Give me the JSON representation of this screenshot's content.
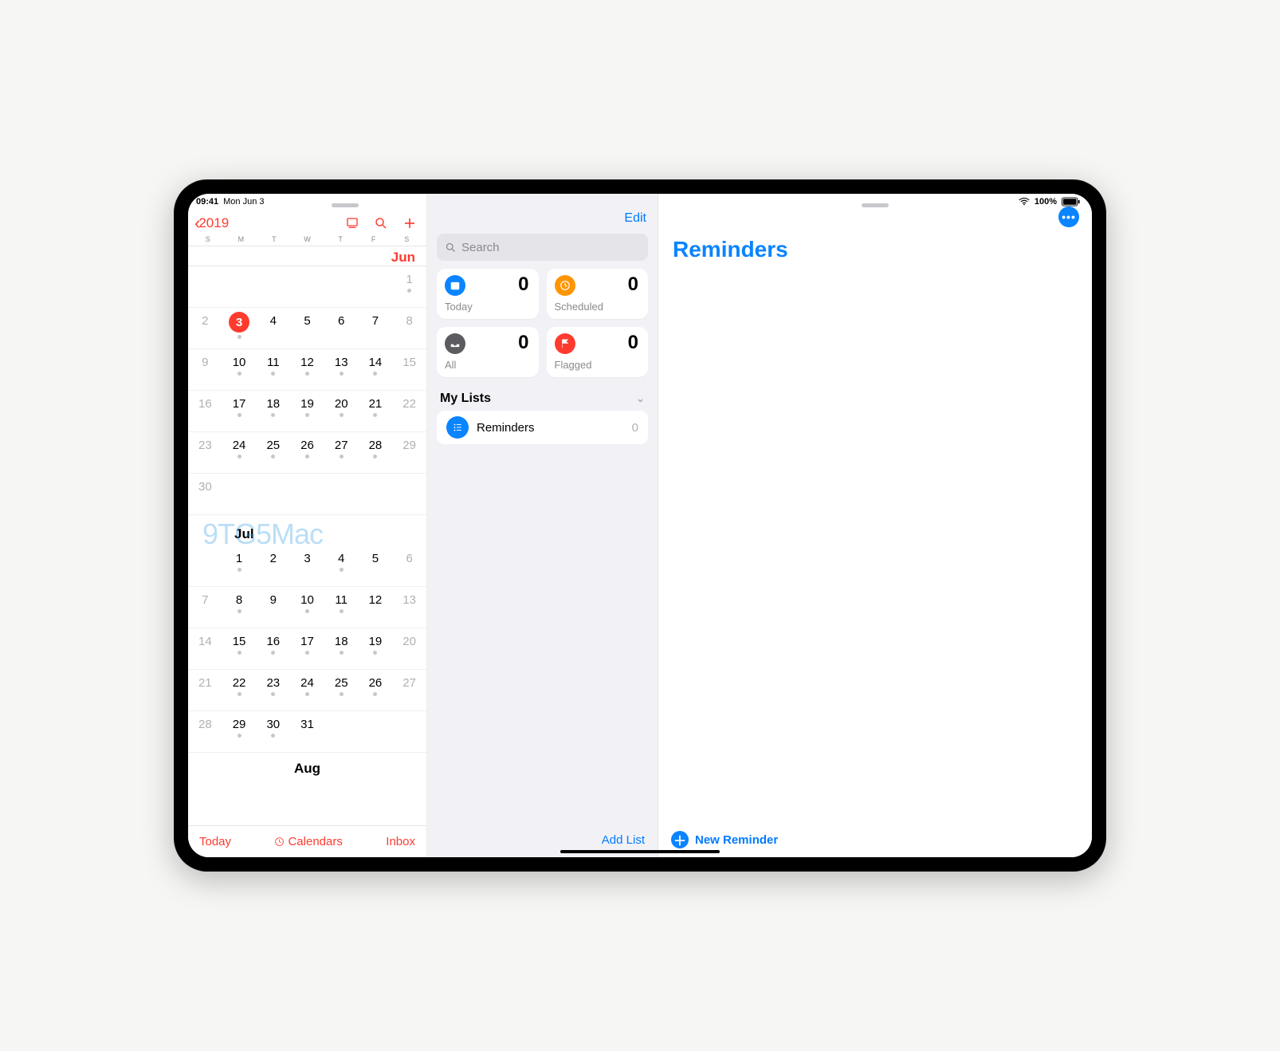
{
  "status": {
    "time": "09:41",
    "date": "Mon Jun 3",
    "battery": "100%"
  },
  "calendar": {
    "back_year": "2019",
    "weekdays": [
      "S",
      "M",
      "T",
      "W",
      "T",
      "F",
      "S"
    ],
    "month_jun": "Jun",
    "month_jul": "Jul",
    "month_aug": "Aug",
    "today_btn": "Today",
    "calendars_btn": "Calendars",
    "inbox_btn": "Inbox",
    "jun": {
      "days": [
        {
          "n": "",
          "w": true
        },
        {
          "n": "",
          "w": false
        },
        {
          "n": "",
          "w": false
        },
        {
          "n": "",
          "w": false
        },
        {
          "n": "",
          "w": false
        },
        {
          "n": "",
          "w": false
        },
        {
          "n": "1",
          "w": true,
          "dot": true
        },
        {
          "n": "2",
          "w": true
        },
        {
          "n": "3",
          "w": false,
          "today": true,
          "dot": true
        },
        {
          "n": "4",
          "w": false
        },
        {
          "n": "5",
          "w": false
        },
        {
          "n": "6",
          "w": false
        },
        {
          "n": "7",
          "w": false
        },
        {
          "n": "8",
          "w": true
        },
        {
          "n": "9",
          "w": true
        },
        {
          "n": "10",
          "w": false,
          "dot": true
        },
        {
          "n": "11",
          "w": false,
          "dot": true
        },
        {
          "n": "12",
          "w": false,
          "dot": true
        },
        {
          "n": "13",
          "w": false,
          "dot": true
        },
        {
          "n": "14",
          "w": false,
          "dot": true
        },
        {
          "n": "15",
          "w": true
        },
        {
          "n": "16",
          "w": true
        },
        {
          "n": "17",
          "w": false,
          "dot": true
        },
        {
          "n": "18",
          "w": false,
          "dot": true
        },
        {
          "n": "19",
          "w": false,
          "dot": true
        },
        {
          "n": "20",
          "w": false,
          "dot": true
        },
        {
          "n": "21",
          "w": false,
          "dot": true
        },
        {
          "n": "22",
          "w": true
        },
        {
          "n": "23",
          "w": true
        },
        {
          "n": "24",
          "w": false,
          "dot": true
        },
        {
          "n": "25",
          "w": false,
          "dot": true
        },
        {
          "n": "26",
          "w": false,
          "dot": true
        },
        {
          "n": "27",
          "w": false,
          "dot": true
        },
        {
          "n": "28",
          "w": false,
          "dot": true
        },
        {
          "n": "29",
          "w": true
        },
        {
          "n": "30",
          "w": true
        },
        {
          "n": "",
          "w": false
        },
        {
          "n": "",
          "w": false
        },
        {
          "n": "",
          "w": false
        },
        {
          "n": "",
          "w": false
        },
        {
          "n": "",
          "w": false
        },
        {
          "n": "",
          "w": true
        }
      ]
    },
    "jul": {
      "days": [
        {
          "n": "",
          "w": true
        },
        {
          "n": "1",
          "w": false,
          "dot": true
        },
        {
          "n": "2",
          "w": false
        },
        {
          "n": "3",
          "w": false
        },
        {
          "n": "4",
          "w": false,
          "dot": true
        },
        {
          "n": "5",
          "w": false
        },
        {
          "n": "6",
          "w": true
        },
        {
          "n": "7",
          "w": true
        },
        {
          "n": "8",
          "w": false,
          "dot": true
        },
        {
          "n": "9",
          "w": false
        },
        {
          "n": "10",
          "w": false,
          "dot": true
        },
        {
          "n": "11",
          "w": false,
          "dot": true
        },
        {
          "n": "12",
          "w": false
        },
        {
          "n": "13",
          "w": true
        },
        {
          "n": "14",
          "w": true
        },
        {
          "n": "15",
          "w": false,
          "dot": true
        },
        {
          "n": "16",
          "w": false,
          "dot": true
        },
        {
          "n": "17",
          "w": false,
          "dot": true
        },
        {
          "n": "18",
          "w": false,
          "dot": true
        },
        {
          "n": "19",
          "w": false,
          "dot": true
        },
        {
          "n": "20",
          "w": true
        },
        {
          "n": "21",
          "w": true
        },
        {
          "n": "22",
          "w": false,
          "dot": true
        },
        {
          "n": "23",
          "w": false,
          "dot": true
        },
        {
          "n": "24",
          "w": false,
          "dot": true
        },
        {
          "n": "25",
          "w": false,
          "dot": true
        },
        {
          "n": "26",
          "w": false,
          "dot": true
        },
        {
          "n": "27",
          "w": true
        },
        {
          "n": "28",
          "w": true
        },
        {
          "n": "29",
          "w": false,
          "dot": true
        },
        {
          "n": "30",
          "w": false,
          "dot": true
        },
        {
          "n": "31",
          "w": false
        },
        {
          "n": "",
          "w": false
        },
        {
          "n": "",
          "w": false
        },
        {
          "n": "",
          "w": true
        }
      ]
    }
  },
  "reminders": {
    "edit": "Edit",
    "search_placeholder": "Search",
    "cards": {
      "today": {
        "label": "Today",
        "count": "0"
      },
      "scheduled": {
        "label": "Scheduled",
        "count": "0"
      },
      "all": {
        "label": "All",
        "count": "0"
      },
      "flagged": {
        "label": "Flagged",
        "count": "0"
      }
    },
    "my_lists": "My Lists",
    "list": {
      "name": "Reminders",
      "count": "0"
    },
    "add_list": "Add List",
    "title": "Reminders",
    "new_reminder": "New Reminder"
  },
  "watermark": "9TG5Mac"
}
